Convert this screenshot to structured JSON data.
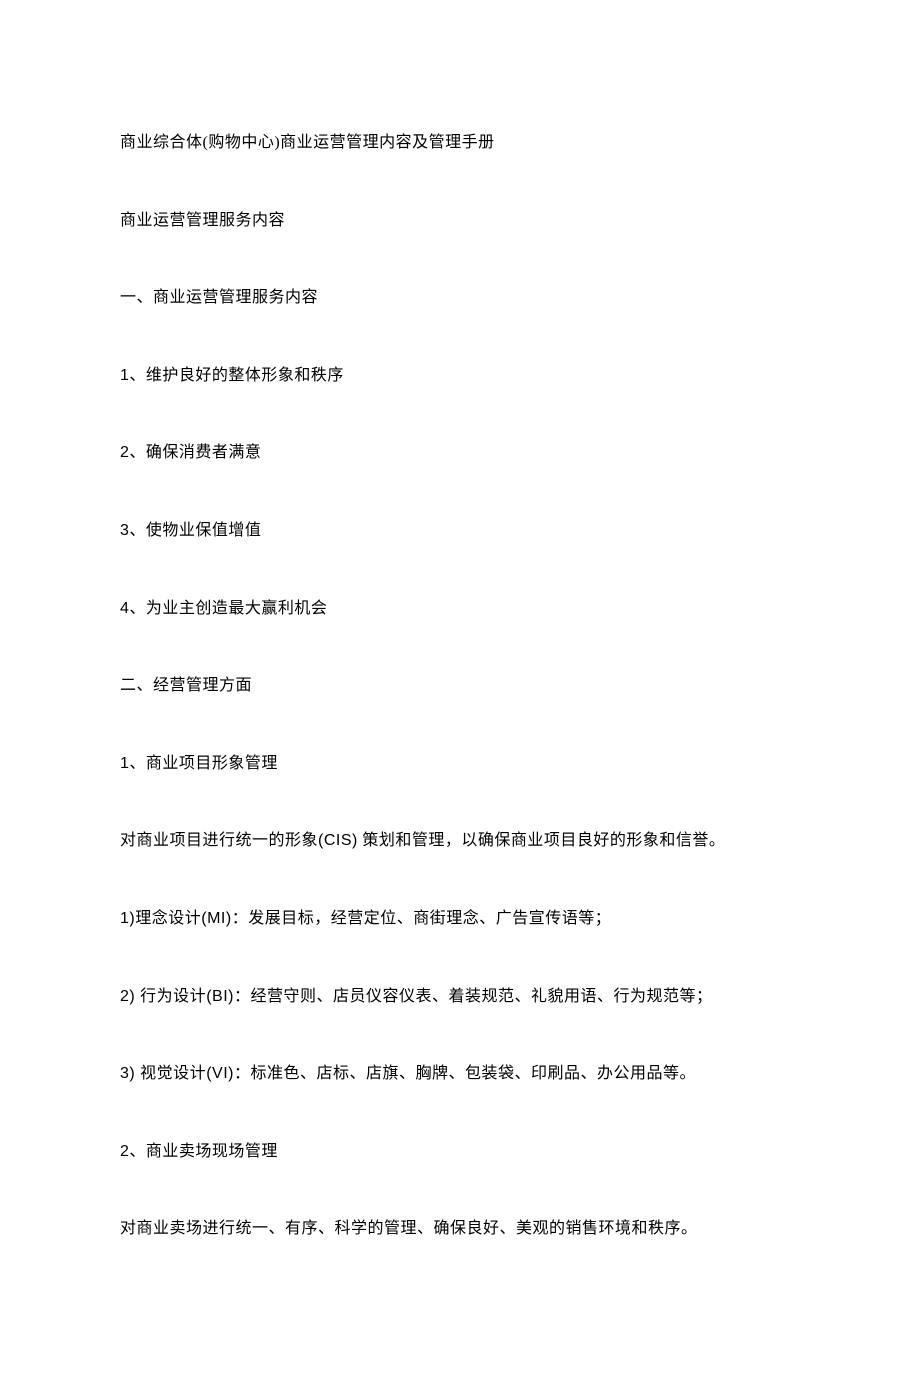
{
  "title": "商业综合体(购物中心)商业运营管理内容及管理手册",
  "subtitle": "商业运营管理服务内容",
  "section1": {
    "heading": "一、商业运营管理服务内容",
    "items": [
      {
        "num": "1",
        "text": "、维护良好的整体形象和秩序"
      },
      {
        "num": "2",
        "text": "、确保消费者满意"
      },
      {
        "num": "3",
        "text": "、使物业保值增值"
      },
      {
        "num": "4",
        "text": "、为业主创造最大赢利机会"
      }
    ]
  },
  "section2": {
    "heading": "二、经营管理方面",
    "sub1": {
      "num": "1",
      "title": "、商业项目形象管理",
      "desc_pre": "对商业项目进行统一的形象",
      "desc_cis": "(CIS)",
      "desc_post": " 策划和管理，以确保商业项目良好的形象和信誉。",
      "points": [
        {
          "num": "1)",
          "label": "理念设计",
          "code": "(MI)",
          "text": "：发展目标，经营定位、商街理念、广告宣传语等；"
        },
        {
          "num": "2) ",
          "label": "行为设计",
          "code": "(BI)",
          "text": "：经营守则、店员仪容仪表、着装规范、礼貌用语、行为规范等；"
        },
        {
          "num": "3) ",
          "label": "视觉设计",
          "code": "(VI)",
          "text": "：标准色、店标、店旗、胸牌、包装袋、印刷品、办公用品等。"
        }
      ]
    },
    "sub2": {
      "num": "2",
      "title": "、商业卖场现场管理",
      "desc": "对商业卖场进行统一、有序、科学的管理、确保良好、美观的销售环境和秩序。"
    }
  }
}
